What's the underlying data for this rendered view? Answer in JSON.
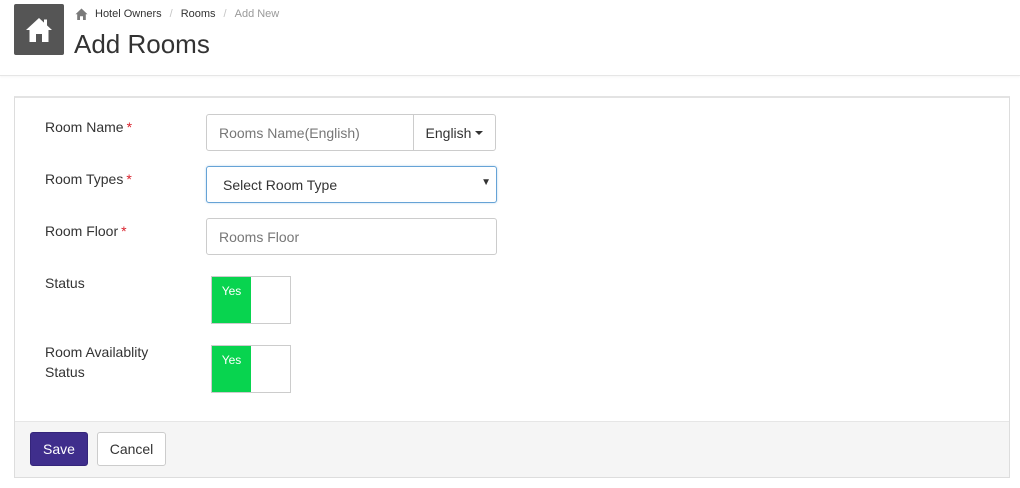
{
  "header": {
    "breadcrumb": {
      "items": [
        "Hotel Owners",
        "Rooms"
      ],
      "current": "Add New",
      "separator": "/"
    },
    "title": "Add Rooms"
  },
  "form": {
    "room_name": {
      "label": "Room Name",
      "required_mark": "*",
      "placeholder": "Rooms Name(English)",
      "language": "English"
    },
    "room_types": {
      "label": "Room Types",
      "required_mark": "*",
      "selected": "Select Room Type"
    },
    "room_floor": {
      "label": "Room Floor",
      "required_mark": "*",
      "placeholder": "Rooms Floor"
    },
    "status": {
      "label": "Status",
      "toggle_text": "Yes",
      "value": true
    },
    "room_availability": {
      "label": "Room Availablity Status",
      "toggle_text": "Yes",
      "value": true
    }
  },
  "actions": {
    "save": "Save",
    "cancel": "Cancel"
  },
  "colors": {
    "accent": "#3f2e8c",
    "toggle_on": "#08d44f",
    "required": "#d9212c",
    "home_tile": "#555555"
  },
  "icons": {
    "home_tile": "home-icon",
    "breadcrumb": "home-icon",
    "language": "caret-down-icon",
    "select": "chevron-down-icon"
  }
}
